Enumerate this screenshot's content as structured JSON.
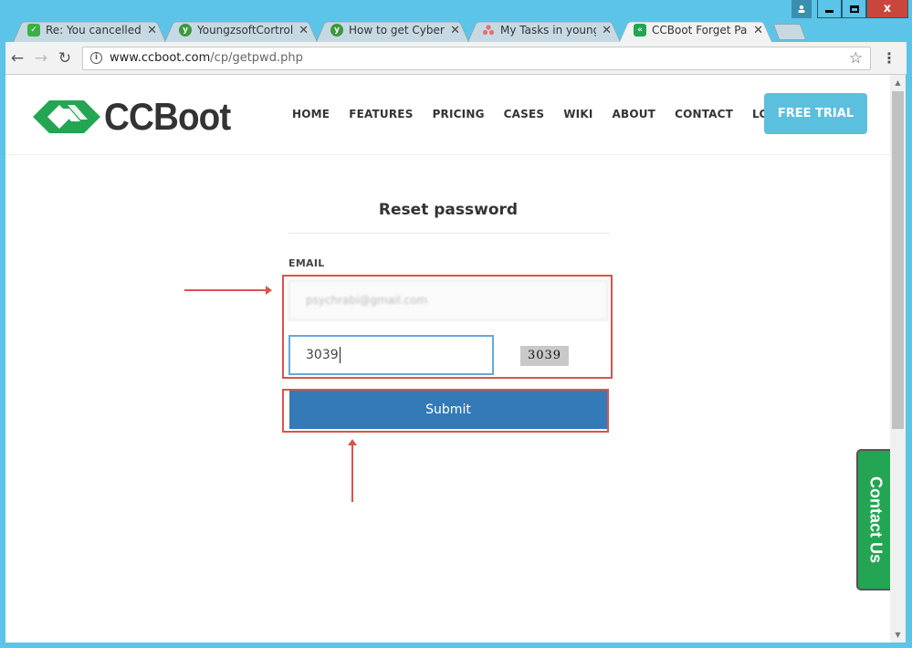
{
  "window": {
    "close_label": "x"
  },
  "tabs": [
    {
      "title": "Re: You cancelled au",
      "icon": "chat-check-icon",
      "icon_color": "#3cb043",
      "active": false
    },
    {
      "title": "YoungzsoftCortrol Pa",
      "icon": "youngzsoft-icon",
      "icon_color": "#3a9a3a",
      "active": false
    },
    {
      "title": "How to get CyberCC",
      "icon": "youngzsoft-icon",
      "icon_color": "#3a9a3a",
      "active": false
    },
    {
      "title": "My Tasks in youngzs",
      "icon": "asana-icon",
      "icon_color": "#f06a6a",
      "active": false
    },
    {
      "title": "CCBoot Forget Passw",
      "icon": "ccboot-icon",
      "icon_color": "#24a553",
      "active": true
    }
  ],
  "toolbar": {
    "url_host": "www.ccboot.com",
    "url_path": "/cp/getpwd.php"
  },
  "site": {
    "logo_text": "CCBoot",
    "brand_green": "#24a553",
    "nav": [
      "HOME",
      "FEATURES",
      "PRICING",
      "CASES",
      "WIKI",
      "ABOUT",
      "CONTACT",
      "LOGIN"
    ],
    "free_trial": "FREE TRIAL",
    "free_trial_color": "#5bc0de"
  },
  "form": {
    "title": "Reset password",
    "email_label": "EMAIL",
    "email_value": "psychrabi@gmail.com",
    "captcha_value": "3039",
    "captcha_image_text": "3039",
    "submit_label": "Submit",
    "submit_color": "#337ab7"
  },
  "annotations": {
    "highlight_color": "#d9534f"
  },
  "contact_us": "Contact Us"
}
